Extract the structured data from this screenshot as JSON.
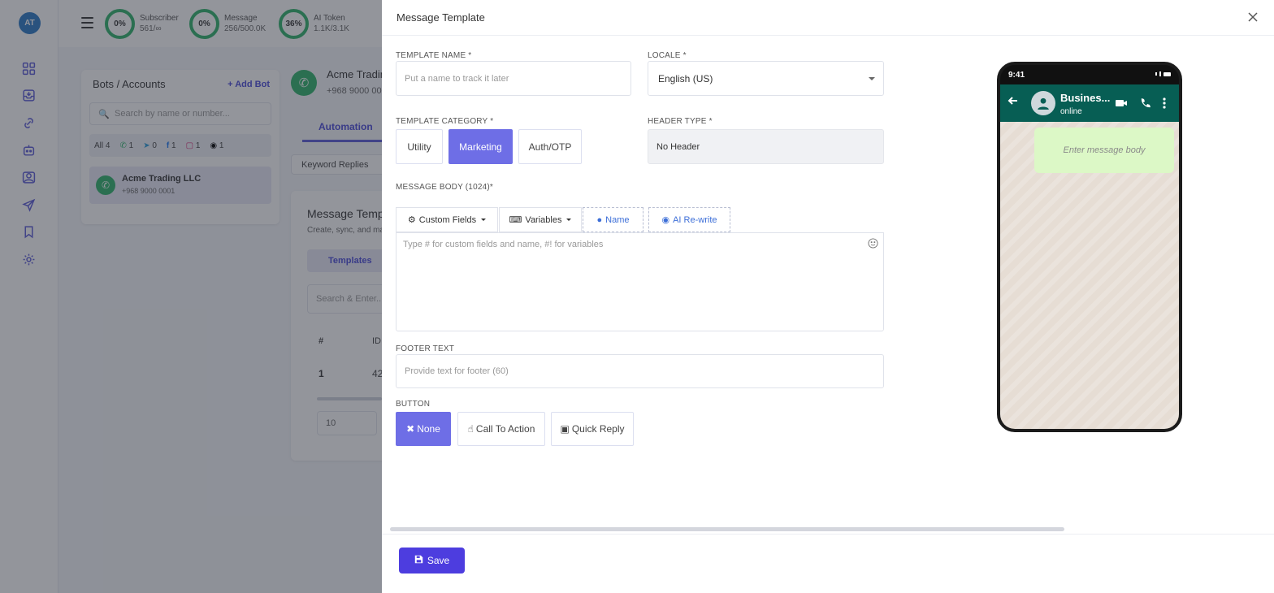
{
  "sidebar": {
    "avatar_initials": "AT"
  },
  "topbar": {
    "stats": [
      {
        "percent": "0%",
        "label": "Subscriber",
        "value": "561/∞"
      },
      {
        "percent": "0%",
        "label": "Message",
        "value": "256/500.0K"
      },
      {
        "percent": "36%",
        "label": "AI Token",
        "value": "1.1K/3.1K"
      }
    ]
  },
  "bots_panel": {
    "title": "Bots / Accounts",
    "add_bot": "+ Add Bot",
    "search_placeholder": "Search by name or number...",
    "filters": [
      {
        "label": "All 4"
      },
      {
        "icon": "whatsapp-icon",
        "count": "1"
      },
      {
        "icon": "telegram-icon",
        "count": "0"
      },
      {
        "icon": "facebook-icon",
        "count": "1"
      },
      {
        "icon": "instagram-icon",
        "count": "1"
      },
      {
        "icon": "tiktok-icon",
        "count": "1"
      }
    ],
    "bot": {
      "name": "Acme Trading LLC",
      "number": "+968 9000 0001"
    }
  },
  "account": {
    "name": "Acme Tradin",
    "number": "+968 9000 00",
    "tab_label": "Automation",
    "keyword_replies": "Keyword Replies",
    "section_title": "Message Temp",
    "section_sub": "Create, sync, and ma",
    "templates_tab": "Templates",
    "search_placeholder": "Search & Enter...",
    "table": {
      "col_hash": "#",
      "col_id": "ID",
      "row_index": "1",
      "row_id": "42"
    },
    "page_size": "10"
  },
  "modal": {
    "title": "Message Template",
    "template_name": {
      "label": "TEMPLATE NAME *",
      "placeholder": "Put a name to track it later",
      "value": ""
    },
    "locale": {
      "label": "LOCALE *",
      "value": "English (US)"
    },
    "category": {
      "label": "TEMPLATE CATEGORY *",
      "options": [
        "Utility",
        "Marketing",
        "Auth/OTP"
      ],
      "selected": "Marketing"
    },
    "header_type": {
      "label": "HEADER TYPE *",
      "value": "No Header"
    },
    "body": {
      "label": "MESSAGE BODY (1024)*",
      "custom_fields": "Custom Fields",
      "variables": "Variables",
      "name": "Name",
      "ai_rewrite": "AI Re-write",
      "placeholder": "Type # for custom fields and name, #! for variables"
    },
    "footer": {
      "label": "FOOTER TEXT",
      "placeholder": "Provide text for footer (60)"
    },
    "button": {
      "label": "BUTTON",
      "options": [
        "None",
        "Call To Action",
        "Quick Reply"
      ],
      "selected": "None"
    },
    "save": "Save"
  },
  "preview": {
    "time": "9:41",
    "contact_name": "Busines...",
    "contact_status": "online",
    "message_placeholder": "Enter message body"
  },
  "colors": {
    "accent": "#6e6ee6",
    "save": "#4d3ddf",
    "wa_header": "#075e54",
    "wa_bubble": "#dcf8c6",
    "ring": "#2fb36b"
  }
}
